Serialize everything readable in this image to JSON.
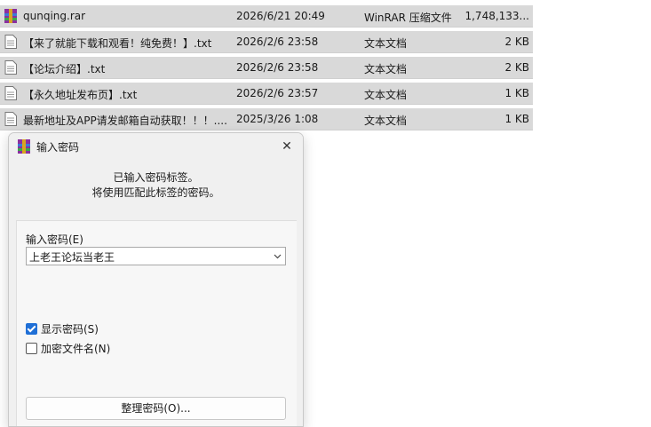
{
  "files": [
    {
      "name": "qunqing.rar",
      "date": "2026/6/21 20:49",
      "type": "WinRAR 压缩文件",
      "size": "1,748,133...",
      "icon": "rar-archive-icon"
    },
    {
      "name": "【来了就能下载和观看！纯免费！】.txt",
      "date": "2026/2/6 23:58",
      "type": "文本文档",
      "size": "2 KB",
      "icon": "text-file-icon"
    },
    {
      "name": "【论坛介绍】.txt",
      "date": "2026/2/6 23:58",
      "type": "文本文档",
      "size": "2 KB",
      "icon": "text-file-icon"
    },
    {
      "name": "【永久地址发布页】.txt",
      "date": "2026/2/6 23:57",
      "type": "文本文档",
      "size": "1 KB",
      "icon": "text-file-icon"
    },
    {
      "name": "最新地址及APP请发邮箱自动获取！！！....",
      "date": "2025/3/26 1:08",
      "type": "文本文档",
      "size": "1 KB",
      "icon": "text-file-icon"
    }
  ],
  "dialog": {
    "title": "输入密码",
    "close_label": "✕",
    "message_line1": "已输入密码标签。",
    "message_line2": "将使用匹配此标签的密码。",
    "password_label": "输入密码(E)",
    "password_value": "上老王论坛当老王",
    "show_password_label": "显示密码(S)",
    "show_password_checked": true,
    "encrypt_names_label": "加密文件名(N)",
    "encrypt_names_checked": false,
    "manage_button_label": "整理密码(O)..."
  },
  "colors": {
    "row_selected_bg": "#d9d9d9",
    "accent": "#1f6fd6",
    "dialog_bg": "#f0f0f0"
  }
}
